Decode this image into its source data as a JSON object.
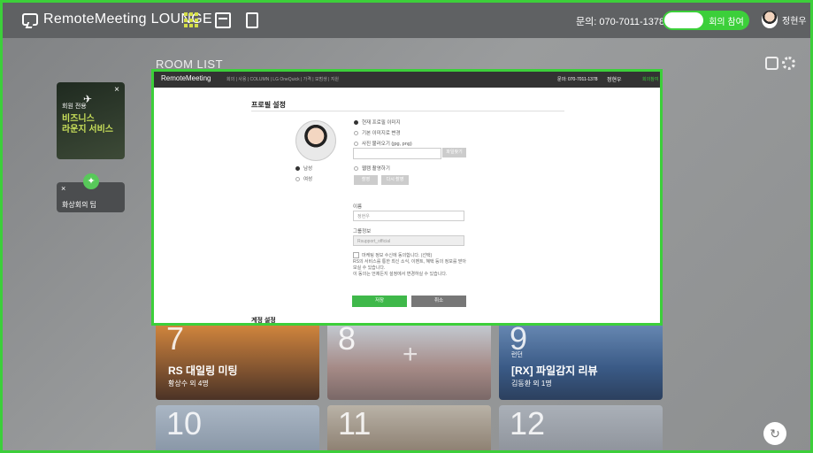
{
  "topbar": {
    "logo": "RemoteMeeting LOUNGE",
    "contact": "문의: 070-7011-1378",
    "join_label": "회의 참여",
    "user_name": "정현우"
  },
  "roomlist": {
    "title": "ROOM LIST"
  },
  "ad_card": {
    "small": "회원 전용",
    "big_line1": "비즈니스",
    "big_line2": "라운지 서비스"
  },
  "tip_card": {
    "label": "화상회의 팁"
  },
  "tiles": [
    {
      "num": "7",
      "title": "RS 대일링 미팅",
      "meta": "황상수 외 4명"
    },
    {
      "num": "8",
      "sub": "",
      "title": "",
      "meta": ""
    },
    {
      "num": "9",
      "sub": "런던",
      "title": "[RX] 파일감지 리뷰",
      "meta": "김동환 외 1명"
    },
    {
      "num": "10"
    },
    {
      "num": "11"
    },
    {
      "num": "12"
    }
  ],
  "modal": {
    "logo": "RemoteMeeting",
    "nav": "회의 | 사용 | COLUMN | LG OneQuick | 가격 | 모범생 | 지원",
    "contact": "문의: 070-7011-1378",
    "user": "정현우",
    "join": "회의참여",
    "section_profile": "프로필 설정",
    "radio_current": "현재 프로필 이미지",
    "radio_default": "기본 이미지로 변경",
    "radio_upload": "사진 불러오기 (jpg, png)",
    "file_btn": "파일찾기",
    "radio_male": "남성",
    "radio_female": "여성",
    "radio_webcam": "웹캠 촬영하기",
    "btn_shoot": "촬영",
    "btn_retake": "다시 촬영",
    "name_label": "이름",
    "name_value": "정현우",
    "group_label": "그룹정보",
    "group_value": "Rsupport_official",
    "consent_line1": "마케팅 정보 수신에 동의합니다. (선택)",
    "consent_line2": "RS의 서비스를 통한 최신 소식, 이벤트, 혜택 등의 정보를 받아 보실 수 있습니다.",
    "consent_line3": "이 동의는 언제든지 설정에서 변경하실 수 있습니다.",
    "btn_save": "저장",
    "btn_cancel": "취소",
    "section_account": "계정 설정"
  }
}
